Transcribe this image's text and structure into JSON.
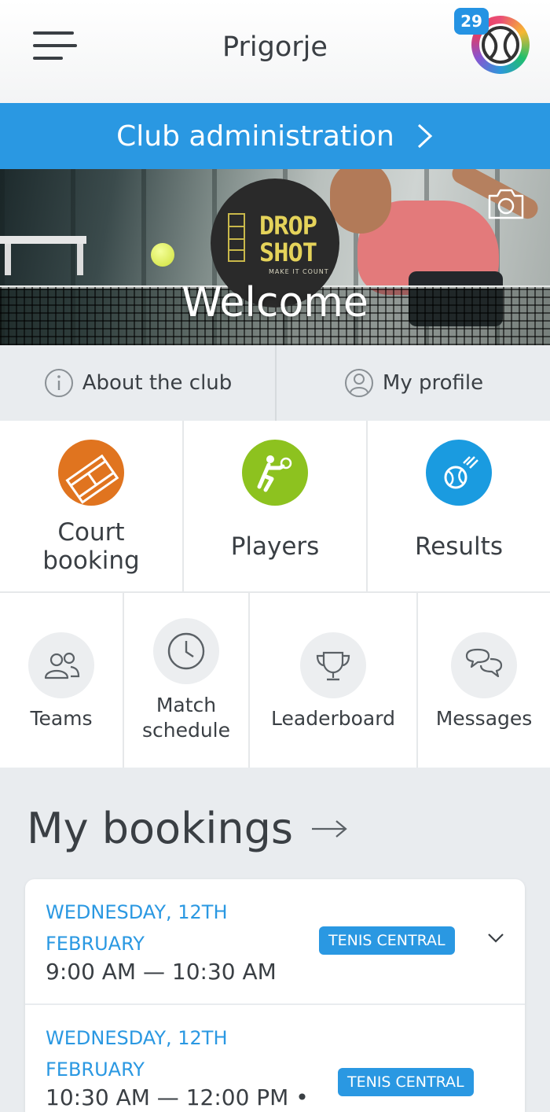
{
  "header": {
    "title": "Prigorje",
    "notification_count": "29",
    "menu_icon": "hamburger-menu-icon",
    "avatar_icon": "tennis-ball-avatar-icon"
  },
  "admin_bar": {
    "label": "Club administration",
    "icon": "chevron-right-icon"
  },
  "hero": {
    "logo": {
      "line1": "DROP",
      "line2": "SHOT",
      "tagline": "MAKE IT COUNT"
    },
    "welcome": "Welcome",
    "camera_icon": "camera-icon"
  },
  "quick_links": [
    {
      "label": "About the club",
      "icon": "info-icon"
    },
    {
      "label": "My profile",
      "icon": "user-icon"
    }
  ],
  "main_tiles": [
    {
      "label_line1": "Court",
      "label_line2": "booking",
      "icon": "court-icon",
      "color": "#e0741f"
    },
    {
      "label": "Players",
      "icon": "player-icon",
      "color": "#8dc21f"
    },
    {
      "label": "Results",
      "icon": "ball-icon",
      "color": "#1a9be0"
    }
  ],
  "small_tiles": [
    {
      "label": "Teams",
      "icon": "users-icon"
    },
    {
      "label_line1": "Match",
      "label_line2": "schedule",
      "icon": "clock-icon"
    },
    {
      "label": "Leaderboard",
      "icon": "trophy-icon"
    },
    {
      "label": "Messages",
      "icon": "chat-icon"
    }
  ],
  "bookings": {
    "title": "My bookings",
    "items": [
      {
        "date_line1": "WEDNESDAY, 12TH",
        "date_line2": "FEBRUARY",
        "time": "9:00 AM — 10:30 AM",
        "court": "TENIS CENTRAL"
      },
      {
        "date_line1": "WEDNESDAY, 12TH",
        "date_line2": "FEBRUARY",
        "time": "10:30 AM — 12:00 PM •",
        "court": "TENIS CENTRAL"
      }
    ]
  },
  "colors": {
    "accent": "#2a98e2",
    "court": "#e0741f",
    "players": "#8dc21f",
    "results": "#1a9be0"
  }
}
